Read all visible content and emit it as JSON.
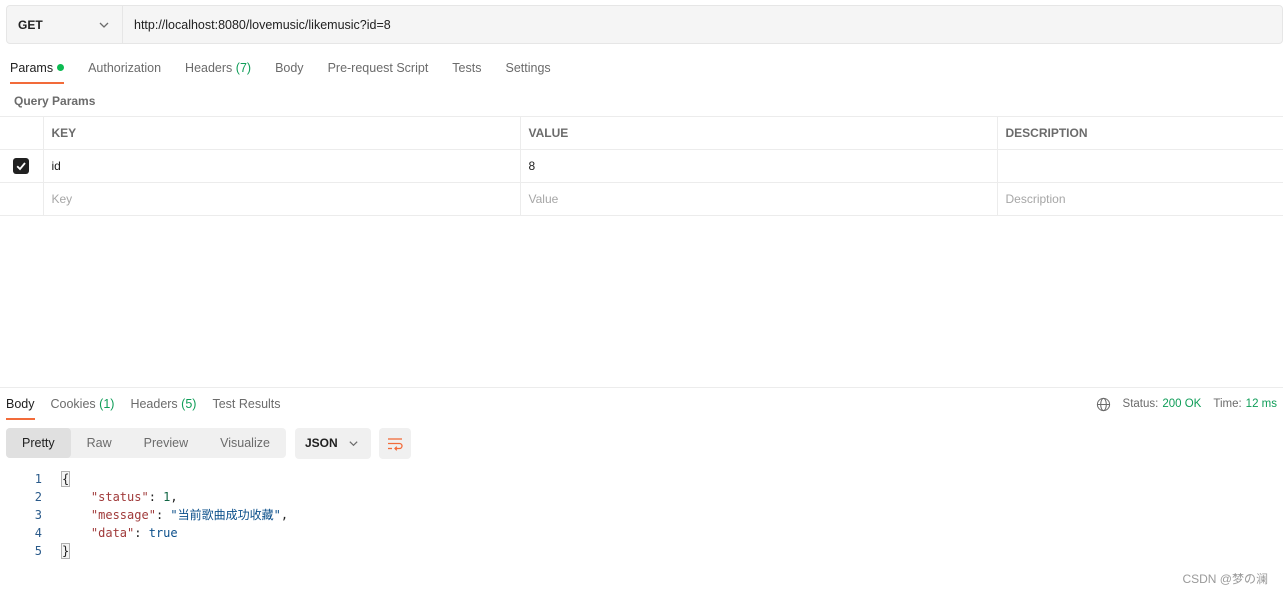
{
  "request": {
    "method": "GET",
    "url": "http://localhost:8080/lovemusic/likemusic?id=8"
  },
  "request_tabs": [
    {
      "label": "Params",
      "count": "",
      "active": true,
      "dot": true
    },
    {
      "label": "Authorization",
      "count": ""
    },
    {
      "label": "Headers",
      "count": "(7)"
    },
    {
      "label": "Body",
      "count": ""
    },
    {
      "label": "Pre-request Script",
      "count": ""
    },
    {
      "label": "Tests",
      "count": ""
    },
    {
      "label": "Settings",
      "count": ""
    }
  ],
  "query_params": {
    "title": "Query Params",
    "headers": {
      "key": "KEY",
      "value": "VALUE",
      "description": "DESCRIPTION"
    },
    "rows": [
      {
        "checked": true,
        "key": "id",
        "value": "8",
        "description": ""
      }
    ],
    "placeholder": {
      "key": "Key",
      "value": "Value",
      "description": "Description"
    }
  },
  "response_tabs": [
    {
      "label": "Body",
      "count": "",
      "active": true
    },
    {
      "label": "Cookies",
      "count": "(1)"
    },
    {
      "label": "Headers",
      "count": "(5)"
    },
    {
      "label": "Test Results",
      "count": ""
    }
  ],
  "status": {
    "status_label": "Status:",
    "status_value": "200 OK",
    "time_label": "Time:",
    "time_value": "12 ms"
  },
  "view_modes": [
    "Pretty",
    "Raw",
    "Preview",
    "Visualize"
  ],
  "active_view_mode": "Pretty",
  "format": "JSON",
  "code_lines": [
    {
      "n": "1"
    },
    {
      "n": "2"
    },
    {
      "n": "3"
    },
    {
      "n": "4"
    },
    {
      "n": "5"
    }
  ],
  "response_json": {
    "status_key": "\"status\"",
    "status_val": "1",
    "message_key": "\"message\"",
    "message_val": "\"当前歌曲成功收藏\"",
    "data_key": "\"data\"",
    "data_val": "true"
  },
  "watermark": "CSDN @梦の澜",
  "colors": {
    "accent": "#f26b3a",
    "success": "#0f9d58"
  },
  "icons": [
    "chevron-down-icon",
    "checkbox-checked-icon",
    "globe-icon",
    "wrap-lines-icon"
  ]
}
